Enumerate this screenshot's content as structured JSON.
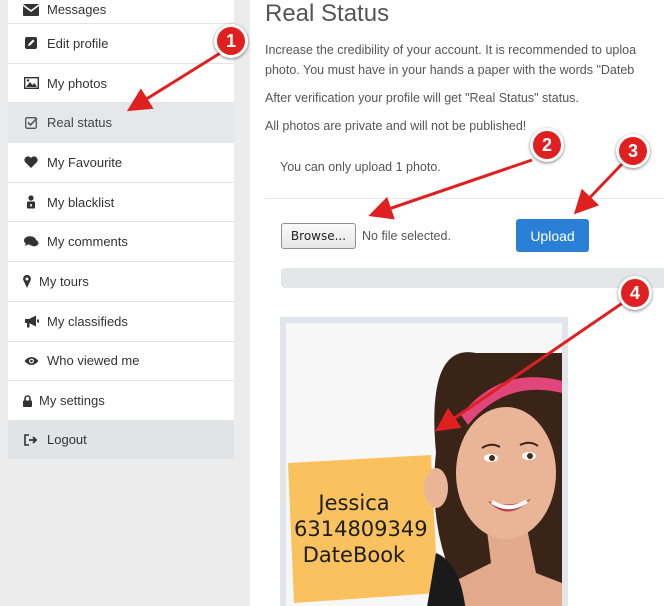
{
  "sidebar": {
    "items": [
      {
        "label": "Messages",
        "icon": "envelope-icon"
      },
      {
        "label": "Edit profile",
        "icon": "edit-icon"
      },
      {
        "label": "My photos",
        "icon": "image-icon"
      },
      {
        "label": "Real status",
        "icon": "check-square-icon",
        "active": true
      },
      {
        "label": "My Favourite",
        "icon": "heart-icon"
      },
      {
        "label": "My blacklist",
        "icon": "user-lock-icon"
      },
      {
        "label": "My comments",
        "icon": "comments-icon"
      },
      {
        "label": "My tours",
        "icon": "map-marker-icon"
      },
      {
        "label": "My classifieds",
        "icon": "bullhorn-icon"
      },
      {
        "label": "Who viewed me",
        "icon": "eye-icon"
      },
      {
        "label": "My settings",
        "icon": "lock-icon"
      },
      {
        "label": "Logout",
        "icon": "sign-out-icon"
      }
    ]
  },
  "main": {
    "title": "Real Status",
    "para1_line1": "Increase the credibility of your account. It is recommended to uploa",
    "para1_line2": "photo. You must have in your hands a paper with the words \"Dateb",
    "para2": "After verification your profile will get \"Real Status\" status.",
    "para3": "All photos are private and will not be published!",
    "upload_notice": "You can only upload 1 photo.",
    "browse_label": "Browse...",
    "file_status": "No file selected.",
    "upload_label": "Upload",
    "sign": {
      "line1": "Jessica",
      "line2": "6314809349",
      "line3": "DateBook"
    }
  },
  "annotations": [
    "1",
    "2",
    "3",
    "4"
  ],
  "colors": {
    "accent": "#2a80d7",
    "annotation": "#e02020",
    "active_bg": "#e6e7e8",
    "sign": "#f9c25e"
  }
}
